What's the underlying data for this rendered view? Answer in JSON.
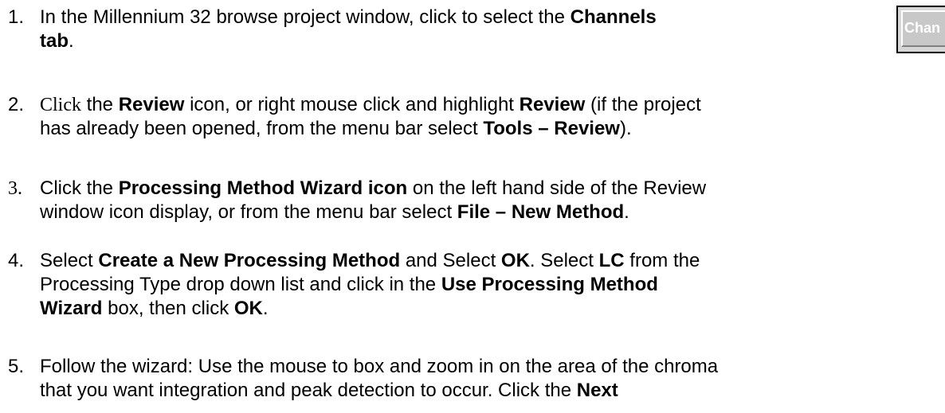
{
  "steps": [
    {
      "number": "1.",
      "lines": [
        [
          "In the Millennium 32 browse project window, click to select the ",
          "Channels"
        ],
        [
          "tab",
          "."
        ]
      ]
    },
    {
      "number": "2.",
      "lead": "Click",
      "lines": [
        [
          " the ",
          "Review",
          " icon, or right mouse click and highlight ",
          "Review",
          " (if the project"
        ],
        [
          "has already been opened, from the menu bar select ",
          "Tools – Review",
          ")."
        ]
      ]
    },
    {
      "number": "3.",
      "lines": [
        [
          " Click the ",
          "Processing Method Wizard icon",
          " on the left hand side of the Review"
        ],
        [
          "window icon display, or from the menu bar select ",
          "File – New Method",
          "."
        ]
      ]
    },
    {
      "number": "4.",
      "lines": [
        [
          "Select ",
          "Create a New Processing Method",
          " and Select ",
          "OK",
          ". Select ",
          "LC",
          " from the"
        ],
        [
          "Processing Type drop down list and click in the ",
          "Use Processing Method"
        ],
        [
          "Wizard",
          " box, then click ",
          "OK",
          "."
        ]
      ]
    },
    {
      "number": "5.",
      "lines": [
        [
          "Follow the wizard: Use the mouse to box and zoom in on the area of the chroma"
        ],
        [
          "that you want integration and peak detection to occur. Click the ",
          "Next"
        ]
      ]
    }
  ],
  "channels_tab": {
    "label": "Chan",
    "icon": "channels-tab-button"
  }
}
